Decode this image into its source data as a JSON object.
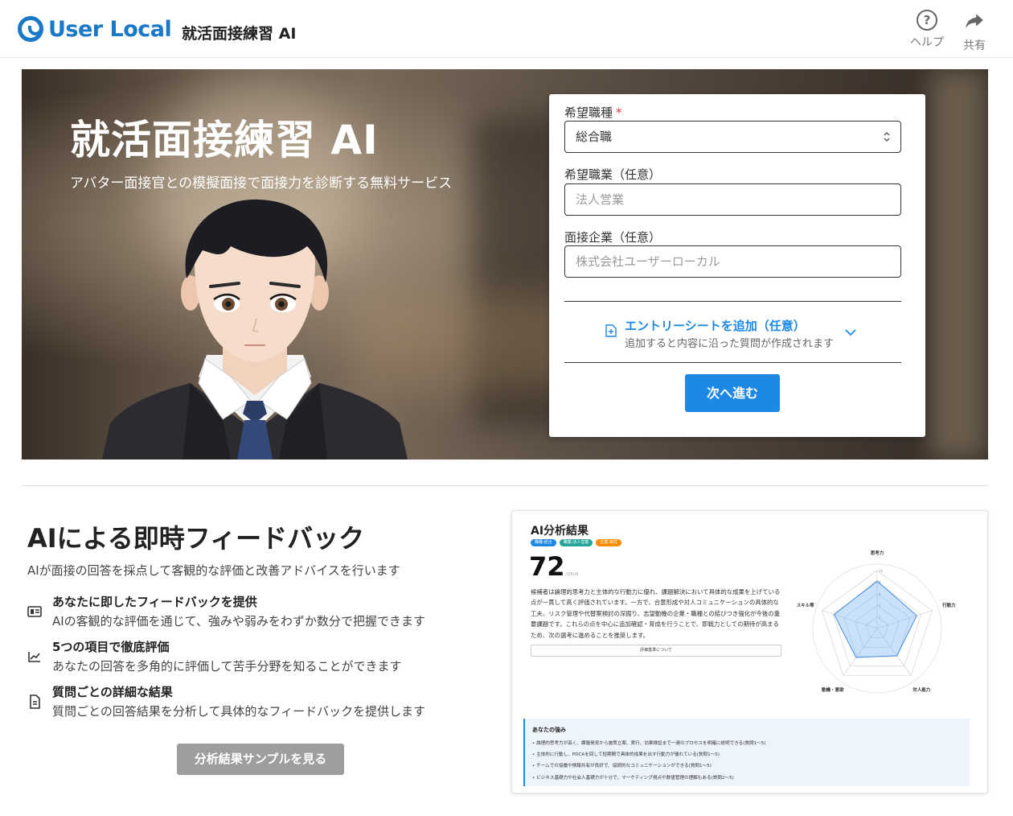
{
  "header": {
    "logo_text": "User Local",
    "app_title": "就活面接練習 AI",
    "help_label": "ヘルプ",
    "share_label": "共有"
  },
  "hero": {
    "title": "就活面接練習 AI",
    "subtitle": "アバター面接官との模擬面接で面接力を診断する無料サービス"
  },
  "form": {
    "job_type_label": "希望職種",
    "required_mark": "*",
    "job_type_value": "総合職",
    "occupation_label": "希望職業（任意）",
    "occupation_placeholder": "法人営業",
    "company_label": "面接企業（任意）",
    "company_placeholder": "株式会社ユーザーローカル",
    "entry_title": "エントリーシートを追加（任意）",
    "entry_sub": "追加すると内容に沿った質問が作成されます",
    "next_button": "次へ進む"
  },
  "features": {
    "title": "AIによる即時フィードバック",
    "subtitle": "AIが面接の回答を採点して客観的な評価と改善アドバイスを行います",
    "items": [
      {
        "heading": "あなたに即したフィードバックを提供",
        "desc": "AIの客観的な評価を通じて、強みや弱みをわずか数分で把握できます",
        "icon": "card-icon"
      },
      {
        "heading": "5つの項目で徹底評価",
        "desc": "あなたの回答を多角的に評価して苦手分野を知ることができます",
        "icon": "trend-chart-icon"
      },
      {
        "heading": "質問ごとの詳細な結果",
        "desc": "質問ごとの回答結果を分析して具体的なフィードバックを提供します",
        "icon": "document-icon"
      }
    ],
    "sample_button": "分析結果サンプルを見る"
  },
  "result_preview": {
    "title": "AI分析結果",
    "tags": [
      {
        "label": "職種:総合",
        "color": "#1e88e5"
      },
      {
        "label": "職業:法人営業",
        "color": "#26a69a"
      },
      {
        "label": "企業:株式",
        "color": "#fb8c00"
      }
    ],
    "score": "72",
    "score_unit": "/100点",
    "summary": "候補者は論理的思考力と主体的な行動力に優れ、課題解決において具体的な成果を上げている点が一貫して高く評価されています。一方で、合意形成や対人コミュニケーションの具体的な工夫、リスク管理や代替案検討の深掘り、志望動機の企業・職種との結びつき強化が今後の重要課題です。これらの点を中心に追加確認・育成を行うことで、即戦力としての期待が高まるため、次の選考に進めることを推奨します。",
    "criteria_button": "評価基準について",
    "radar_axes": [
      "思考力",
      "行動力",
      "対人能力",
      "動機・意欲",
      "スキル等"
    ],
    "radar_values": [
      0.82,
      0.72,
      0.58,
      0.62,
      0.78
    ],
    "radar_ticks": [
      "2",
      "4",
      "6",
      "8",
      "10"
    ],
    "strengths_title": "あなたの強み",
    "strengths": [
      "論理的思考力が高く、課題発見から施策立案、実行、効果検証まで一連のプロセスを明確に説明できる(質問1〜5)",
      "主体的に行動し、PDCAを回して短期間で具体的成果を出す行動力が優れている(質問1〜5)",
      "チームでの協働や情報共有が良好で、協調的なコミュニケーションができる(質問1〜5)",
      "ビジネス基礎力や社会人基礎力が十分で、マーケティング視点や数値管理の理解もある(質問2〜5)"
    ]
  }
}
